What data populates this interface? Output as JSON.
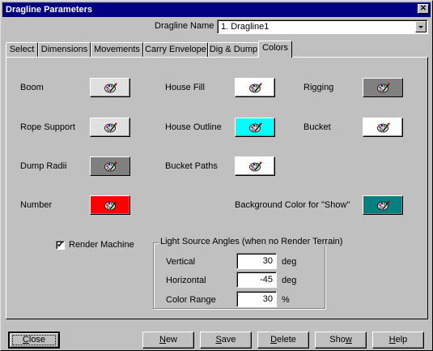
{
  "window": {
    "title": "Dragline Parameters",
    "close_glyph": "✕"
  },
  "dragline_name": {
    "label": "Dragline Name",
    "value": "1. Dragline1"
  },
  "tabs": [
    {
      "label": "Select"
    },
    {
      "label": "Dimensions"
    },
    {
      "label": "Movements"
    },
    {
      "label": "Carry Envelope"
    },
    {
      "label": "Dig & Dump"
    },
    {
      "label": "Colors"
    }
  ],
  "colors": {
    "boom": {
      "label": "Boom",
      "color": "#e0e0e0"
    },
    "house_fill": {
      "label": "House Fill",
      "color": "#ffffff"
    },
    "rigging": {
      "label": "Rigging",
      "color": "#808080"
    },
    "rope_support": {
      "label": "Rope Support",
      "color": "#e0e0e0"
    },
    "house_outline": {
      "label": "House Outline",
      "color": "#00ffff"
    },
    "bucket": {
      "label": "Bucket",
      "color": "#ffffff"
    },
    "dump_radii": {
      "label": "Dump Radii",
      "color": "#808080"
    },
    "bucket_paths": {
      "label": "Bucket Paths",
      "color": "#ffffff"
    },
    "number": {
      "label": "Number",
      "color": "#ff0000"
    },
    "background_show": {
      "label": "Background Color for \"Show\"",
      "color": "#008080"
    }
  },
  "render_machine": {
    "label": "Render Machine",
    "check_glyph": "✔"
  },
  "light_source": {
    "caption": "Light Source Angles (when no Render Terrain)",
    "vertical": {
      "label": "Vertical",
      "value": "30",
      "unit": "deg"
    },
    "horizontal": {
      "label": "Horizontal",
      "value": "-45",
      "unit": "deg"
    },
    "color_range": {
      "label": "Color Range",
      "value": "30",
      "unit": "%"
    }
  },
  "buttons": {
    "close": {
      "first": "C",
      "rest": "lose"
    },
    "new": {
      "first": "N",
      "rest": "ew"
    },
    "save": {
      "first": "S",
      "rest": "ave"
    },
    "delete": {
      "first": "D",
      "rest": "elete"
    },
    "show": {
      "pre": "Sho",
      "key": "w"
    },
    "help": {
      "first": "H",
      "rest": "elp"
    }
  }
}
